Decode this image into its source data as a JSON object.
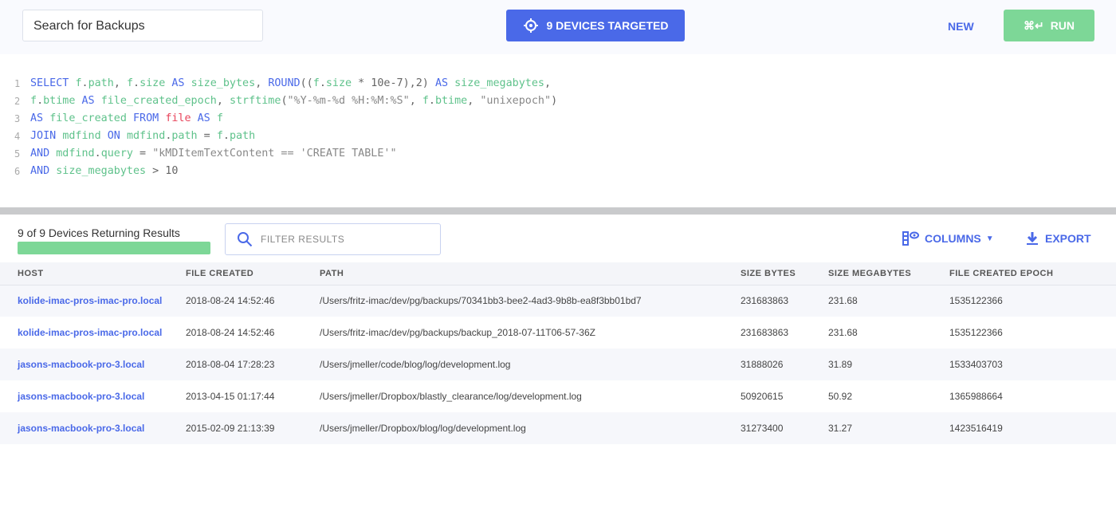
{
  "header": {
    "search_placeholder": "Search for Backups",
    "targeted_label": "9 DEVICES TARGETED",
    "new_label": "NEW",
    "run_shortcut": "⌘↵",
    "run_label": "RUN"
  },
  "colors": {
    "accent": "#4a69e8",
    "success": "#7dd797"
  },
  "query": [
    [
      [
        "kw",
        "SELECT "
      ],
      [
        "id",
        "f"
      ],
      [
        "tx",
        "."
      ],
      [
        "id",
        "path"
      ],
      [
        "tx",
        ", "
      ],
      [
        "id",
        "f"
      ],
      [
        "tx",
        "."
      ],
      [
        "id",
        "size "
      ],
      [
        "kw",
        "AS "
      ],
      [
        "id",
        "size_bytes"
      ],
      [
        "tx",
        ", "
      ],
      [
        "kw",
        "ROUND"
      ],
      [
        "tx",
        "(("
      ],
      [
        "id",
        "f"
      ],
      [
        "tx",
        "."
      ],
      [
        "id",
        "size"
      ],
      [
        "tx",
        " * 10e-7),2) "
      ],
      [
        "kw",
        "AS "
      ],
      [
        "id",
        "size_megabytes"
      ],
      [
        "tx",
        ","
      ]
    ],
    [
      [
        "id",
        "f"
      ],
      [
        "tx",
        "."
      ],
      [
        "id",
        "btime "
      ],
      [
        "kw",
        "AS "
      ],
      [
        "id",
        "file_created_epoch"
      ],
      [
        "tx",
        ", "
      ],
      [
        "id",
        "strftime"
      ],
      [
        "tx",
        "("
      ],
      [
        "st",
        "\"%Y-%m-%d %H:%M:%S\""
      ],
      [
        "tx",
        ", "
      ],
      [
        "id",
        "f"
      ],
      [
        "tx",
        "."
      ],
      [
        "id",
        "btime"
      ],
      [
        "tx",
        ", "
      ],
      [
        "st",
        "\"unixepoch\""
      ],
      [
        "tx",
        ")"
      ]
    ],
    [
      [
        "kw",
        "AS "
      ],
      [
        "id",
        "file_created "
      ],
      [
        "kw",
        "FROM "
      ],
      [
        "rd",
        "file "
      ],
      [
        "kw",
        "AS "
      ],
      [
        "id",
        "f"
      ]
    ],
    [
      [
        "kw",
        "JOIN "
      ],
      [
        "id",
        "mdfind "
      ],
      [
        "kw",
        "ON "
      ],
      [
        "id",
        "mdfind"
      ],
      [
        "tx",
        "."
      ],
      [
        "id",
        "path"
      ],
      [
        "tx",
        " = "
      ],
      [
        "id",
        "f"
      ],
      [
        "tx",
        "."
      ],
      [
        "id",
        "path"
      ]
    ],
    [
      [
        "kw",
        "AND "
      ],
      [
        "id",
        "mdfind"
      ],
      [
        "tx",
        "."
      ],
      [
        "id",
        "query"
      ],
      [
        "tx",
        " = "
      ],
      [
        "st",
        "\"kMDItemTextContent == 'CREATE TABLE'\""
      ]
    ],
    [
      [
        "kw",
        "AND "
      ],
      [
        "id",
        "size_megabytes"
      ],
      [
        "tx",
        " > 10"
      ]
    ]
  ],
  "results": {
    "status": "9 of 9 Devices Returning Results",
    "progress": 1.0,
    "filter_placeholder": "FILTER RESULTS",
    "columns_label": "COLUMNS",
    "export_label": "EXPORT",
    "headers": [
      "HOST",
      "FILE CREATED",
      "PATH",
      "SIZE BYTES",
      "SIZE MEGABYTES",
      "FILE CREATED EPOCH"
    ],
    "rows": [
      [
        "kolide-imac-pros-imac-pro.local",
        "2018-08-24 14:52:46",
        "/Users/fritz-imac/dev/pg/backups/70341bb3-bee2-4ad3-9b8b-ea8f3bb01bd7",
        "231683863",
        "231.68",
        "1535122366"
      ],
      [
        "kolide-imac-pros-imac-pro.local",
        "2018-08-24 14:52:46",
        "/Users/fritz-imac/dev/pg/backups/backup_2018-07-11T06-57-36Z",
        "231683863",
        "231.68",
        "1535122366"
      ],
      [
        "jasons-macbook-pro-3.local",
        "2018-08-04 17:28:23",
        "/Users/jmeller/code/blog/log/development.log",
        "31888026",
        "31.89",
        "1533403703"
      ],
      [
        "jasons-macbook-pro-3.local",
        "2013-04-15 01:17:44",
        "/Users/jmeller/Dropbox/blastly_clearance/log/development.log",
        "50920615",
        "50.92",
        "1365988664"
      ],
      [
        "jasons-macbook-pro-3.local",
        "2015-02-09 21:13:39",
        "/Users/jmeller/Dropbox/blog/log/development.log",
        "31273400",
        "31.27",
        "1423516419"
      ]
    ]
  }
}
